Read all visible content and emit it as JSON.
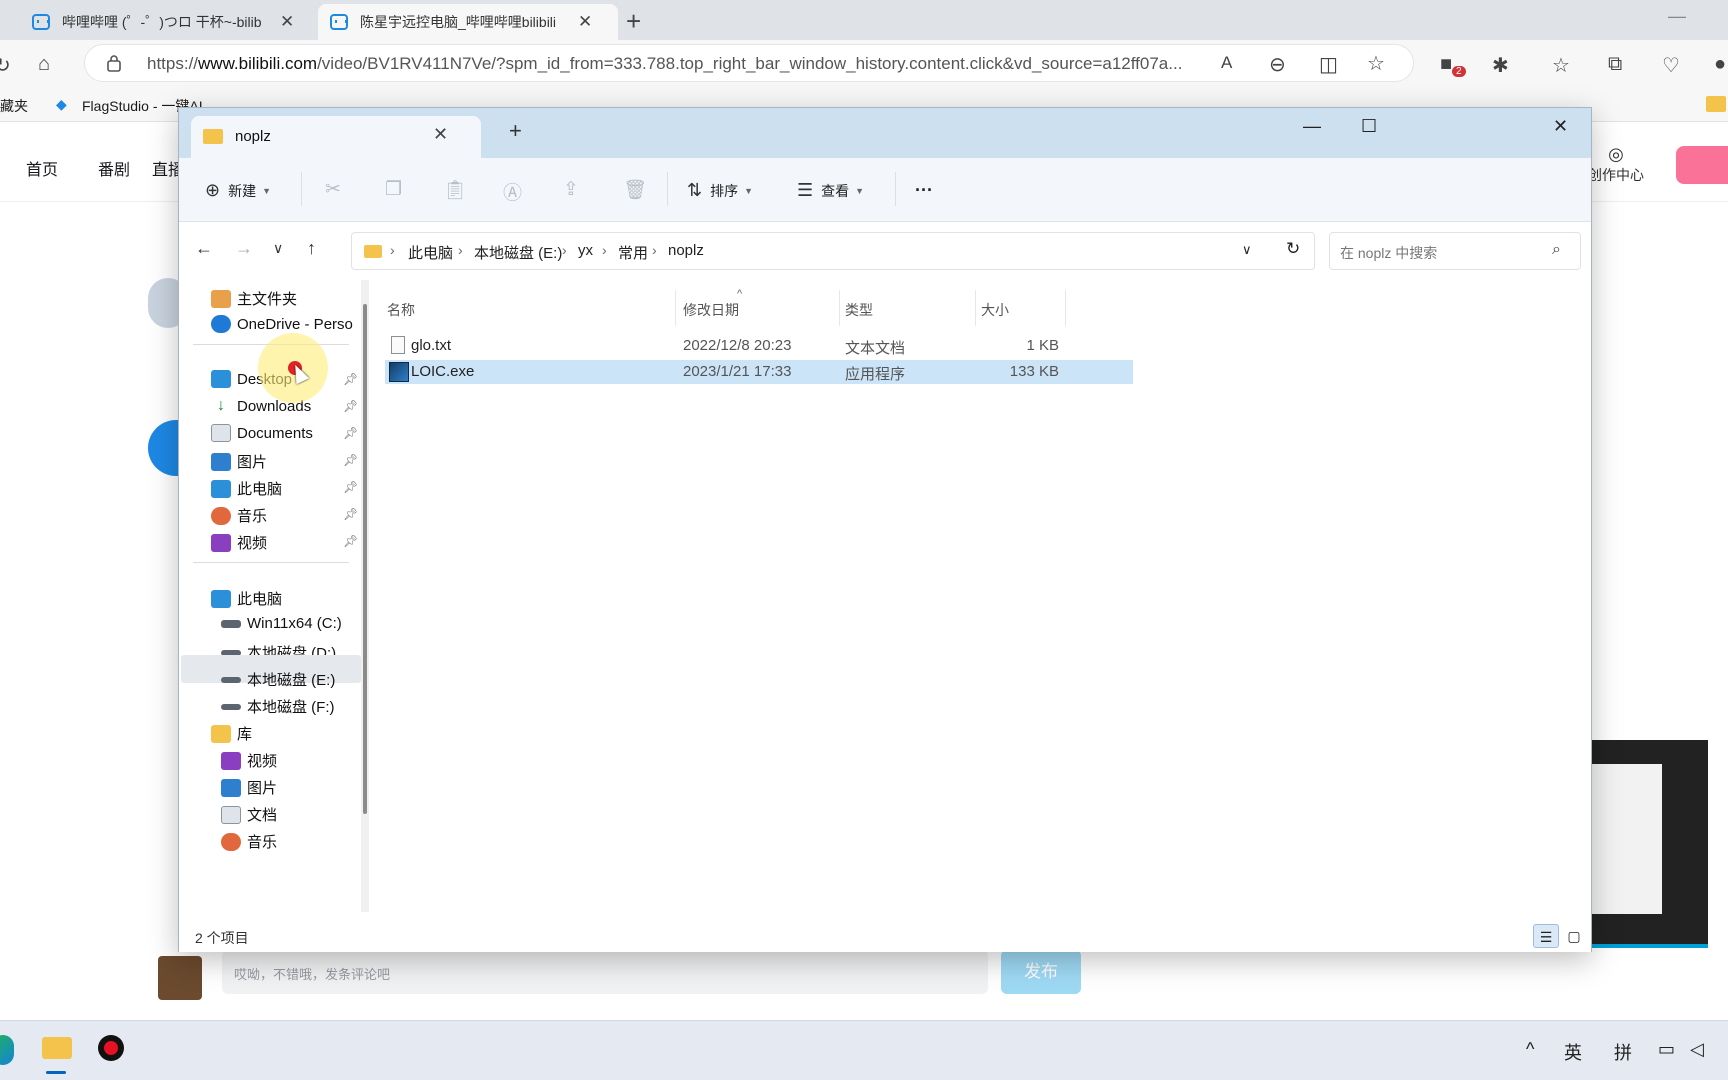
{
  "browser": {
    "tabs": [
      {
        "title": "哔哩哔哩 (゜-゜)つロ 干杯~-bilib",
        "active": false
      },
      {
        "title": "陈星宇远控电脑_哔哩哔哩bilibili",
        "active": true
      }
    ],
    "new_tab": "+",
    "address": {
      "url_prefix": "https://",
      "url_domain": "www.bilibili.com",
      "url_rest": "/video/BV1RV411N7Ve/?spm_id_from=333.788.top_right_bar_window_history.content.click&vd_source=a12ff07a..."
    },
    "extension_badge": "2",
    "favorites": [
      {
        "label": "藏夹"
      },
      {
        "label": "FlagStudio - 一键AI..."
      }
    ]
  },
  "bilibili": {
    "nav": [
      "首页",
      "番剧",
      "直播"
    ],
    "creator_center": "创作中心",
    "comment_placeholder": "哎呦，不错哦，发条评论吧",
    "publish_label": "发布"
  },
  "explorer": {
    "tab_title": "noplz",
    "window_controls": {
      "minimize": "—",
      "maximize": "☐",
      "close": "✕"
    },
    "commands": {
      "new_label": "新建",
      "sort_label": "排序",
      "view_label": "查看",
      "more_label": "···"
    },
    "breadcrumbs": [
      "此电脑",
      "本地磁盘 (E:)",
      "yx",
      "常用",
      "noplz"
    ],
    "search_placeholder": "在 noplz 中搜索",
    "sidebar": {
      "top": [
        {
          "label": "主文件夹",
          "icon": "home-icon"
        },
        {
          "label": "OneDrive - Perso",
          "icon": "cloud-icon"
        }
      ],
      "quick_access": [
        {
          "label": "Desktop",
          "icon": "desktop-icon"
        },
        {
          "label": "Downloads",
          "icon": "download-icon"
        },
        {
          "label": "Documents",
          "icon": "document-icon"
        },
        {
          "label": "图片",
          "icon": "pictures-icon"
        },
        {
          "label": "此电脑",
          "icon": "computer-icon"
        },
        {
          "label": "音乐",
          "icon": "music-icon"
        },
        {
          "label": "视频",
          "icon": "video-icon"
        }
      ],
      "this_pc": {
        "label": "此电脑",
        "icon": "computer-icon"
      },
      "drives": [
        {
          "label": "Win11x64 (C:)",
          "icon": "drive-icon"
        },
        {
          "label": "本地磁盘 (D:)",
          "icon": "drive-icon"
        },
        {
          "label": "本地磁盘 (E:)",
          "icon": "drive-icon",
          "selected": true
        },
        {
          "label": "本地磁盘 (F:)",
          "icon": "drive-icon"
        }
      ],
      "libraries": {
        "label": "库",
        "icon": "library-icon"
      },
      "library_items": [
        {
          "label": "视频",
          "icon": "video-icon"
        },
        {
          "label": "图片",
          "icon": "pictures-icon"
        },
        {
          "label": "文档",
          "icon": "document-icon"
        },
        {
          "label": "音乐",
          "icon": "music-icon"
        }
      ]
    },
    "columns": {
      "name": "名称",
      "date": "修改日期",
      "type": "类型",
      "size": "大小"
    },
    "files": [
      {
        "name": "glo.txt",
        "date": "2022/12/8 20:23",
        "type": "文本文档",
        "size": "1 KB",
        "icon": "text-file-icon",
        "selected": false
      },
      {
        "name": "LOIC.exe",
        "date": "2023/1/21 17:33",
        "type": "应用程序",
        "size": "133 KB",
        "icon": "exe-icon",
        "selected": true
      }
    ],
    "status": "2 个项目"
  },
  "taskbar": {
    "ime_lang": "英",
    "ime_mode": "拼"
  }
}
